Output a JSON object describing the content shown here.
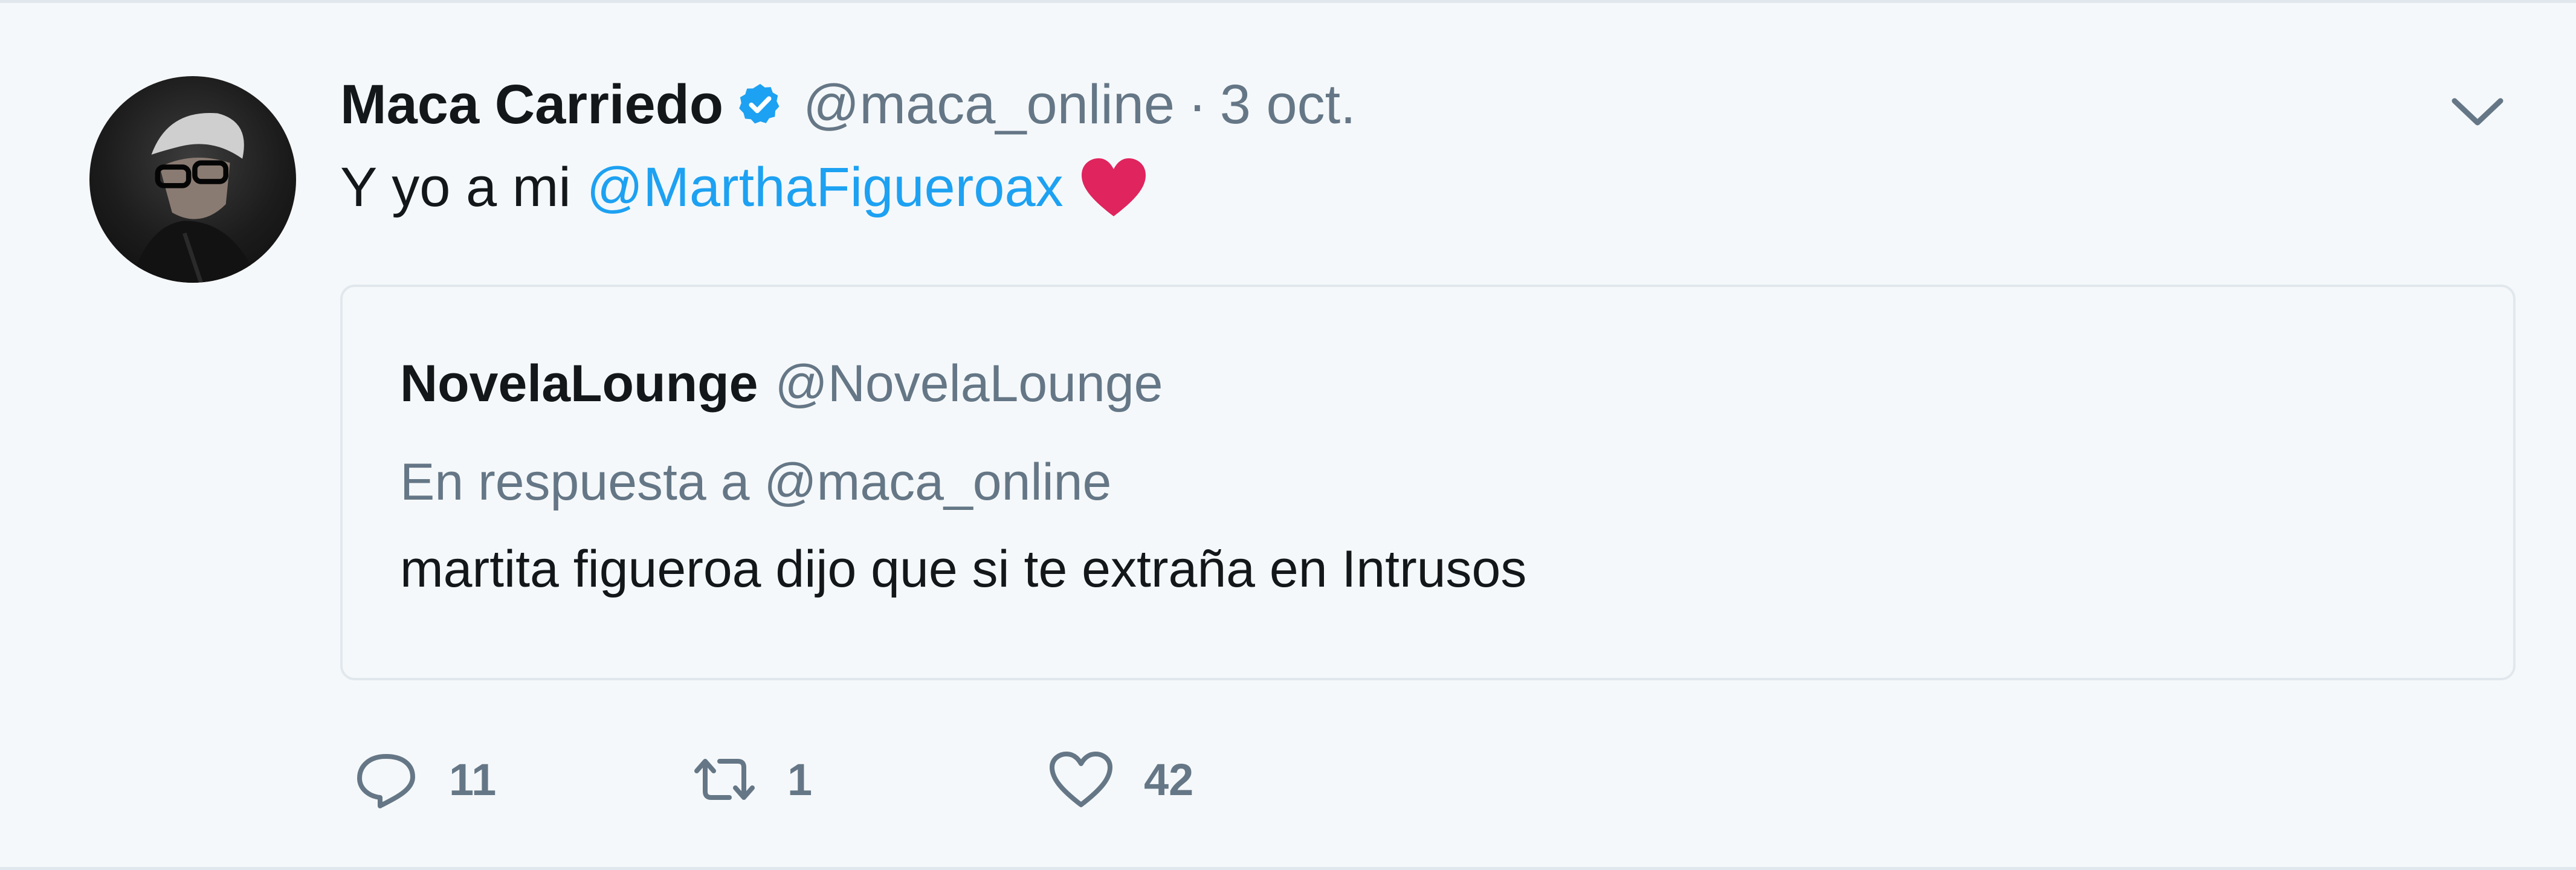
{
  "tweet": {
    "author_name": "Maca Carriedo",
    "author_handle": "@maca_online",
    "separator": "·",
    "timestamp": "3 oct.",
    "text": "Y yo a mi",
    "mention": "@MarthaFigueroax",
    "verified": true
  },
  "quoted_tweet": {
    "author_name": "NovelaLounge",
    "author_handle": "@NovelaLounge",
    "reply_context": "En respuesta a @maca_online",
    "text": "martita figueroa dijo que si te extraña en Intrusos"
  },
  "actions": {
    "replies": "11",
    "retweets": "1",
    "likes": "42"
  },
  "icons": {
    "verified": "verified-badge-icon",
    "more": "chevron-down-icon",
    "reply": "reply-icon",
    "retweet": "retweet-icon",
    "like": "heart-icon",
    "emoji": "red-heart-emoji"
  },
  "colors": {
    "link": "#1da1f2",
    "secondary_text": "#657786",
    "primary_text": "#14171a",
    "heart_emoji": "#e0245e"
  }
}
